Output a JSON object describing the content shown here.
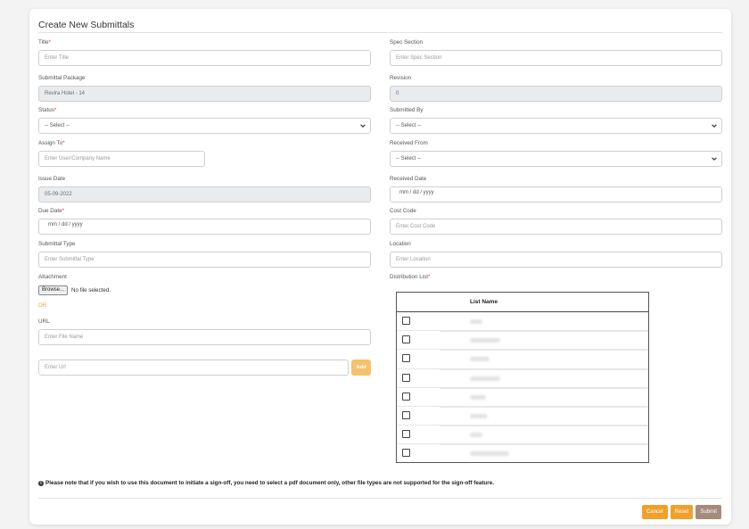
{
  "title": "Create New Submittals",
  "left": {
    "title_label": "Title",
    "title_placeholder": "Enter Title",
    "package_label": "Submittal Package",
    "package_value": "Revira Hotel - 14",
    "status_label": "Status",
    "status_value": "-- Select --",
    "assign_label": "Assign To",
    "assign_placeholder": "Enter User/Company Name",
    "issue_label": "Issue Date",
    "issue_value": "05-09-2022",
    "due_label": "Due Date",
    "due_value": "mm / dd / yyyy",
    "type_label": "Submittal Type",
    "type_placeholder": "Enter Submittal Type",
    "attach_label": "Attachment",
    "browse_label": "Browse...",
    "no_file": "No file selected.",
    "or_text": "OR",
    "url_label": "URL",
    "file_name_placeholder": "Enter File Name",
    "url_placeholder": "Enter Url",
    "add_label": "Add"
  },
  "right": {
    "spec_label": "Spec Section",
    "spec_placeholder": "Enter Spec Section",
    "revision_label": "Revision",
    "revision_value": "0",
    "submitted_label": "Submitted By",
    "submitted_value": "-- Select --",
    "received_from_label": "Received From",
    "received_from_value": "-- Select --",
    "received_date_label": "Received Date",
    "received_date_value": "mm / dd / yyyy",
    "cost_label": "Cost Code",
    "cost_placeholder": "Enter Cost Code",
    "location_label": "Location",
    "location_placeholder": "Enter Location",
    "dist_label": "Distribution List",
    "list_header": "List Name"
  },
  "note": "Please note that if you wish to use this document to initiate a sign-off, you need to select a pdf document only, other file types are not supported for the sign-off feature.",
  "buttons": {
    "cancel": "Cancel",
    "reset": "Reset",
    "submit": "Submit"
  },
  "colors": {
    "accent": "#f0a12c",
    "submit": "#a68a7c",
    "required": "#e53935"
  }
}
